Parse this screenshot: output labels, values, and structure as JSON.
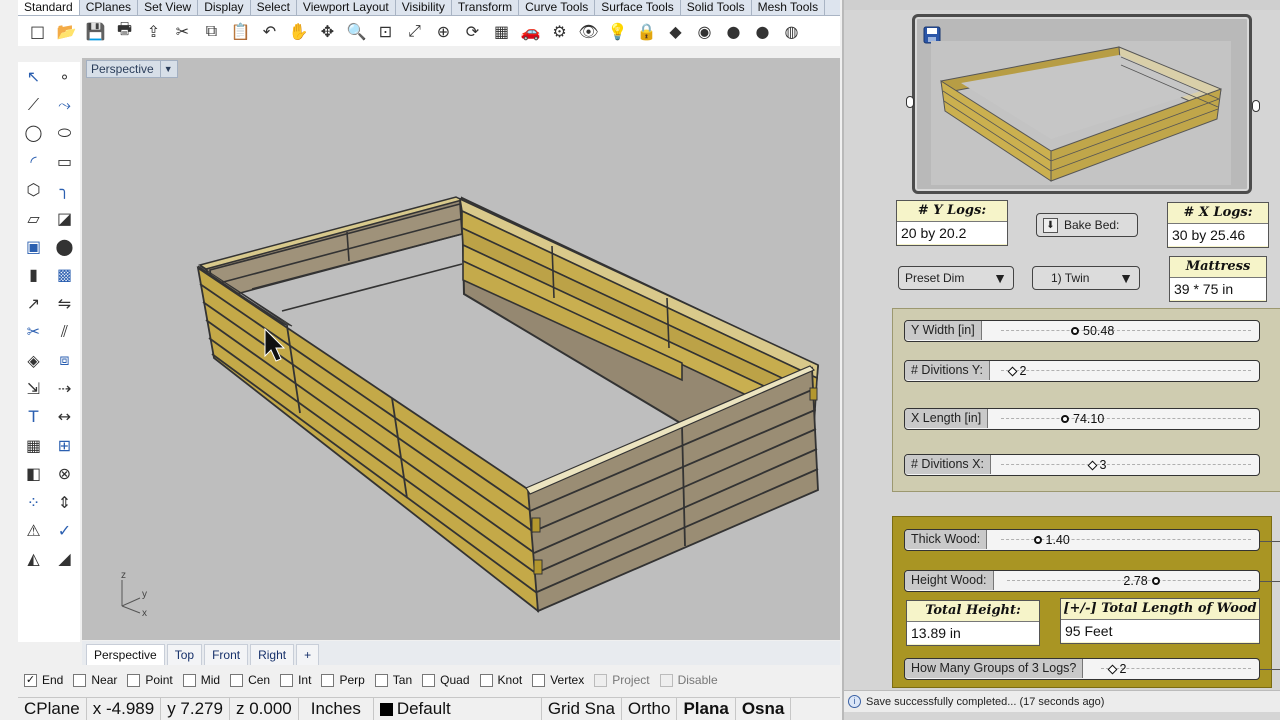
{
  "rhino": {
    "tabs": [
      "Standard",
      "CPlanes",
      "Set View",
      "Display",
      "Select",
      "Viewport Layout",
      "Visibility",
      "Transform",
      "Curve Tools",
      "Surface Tools",
      "Solid Tools",
      "Mesh Tools"
    ],
    "toolbar_icons": [
      "new-file-icon",
      "open-folder-icon",
      "save-icon",
      "print-icon",
      "import-icon",
      "cut-icon",
      "copy-icon",
      "paste-icon",
      "undo-icon",
      "pan-hand-icon",
      "move-view-icon",
      "zoom-icon",
      "zoom-window-icon",
      "zoom-extents-icon",
      "zoom-selected-icon",
      "rotate-view-icon",
      "four-viewports-icon",
      "car-icon",
      "properties-icon",
      "hide-icon",
      "light-bulb-icon",
      "lock-icon",
      "layer-icon",
      "color-wheel-icon",
      "shaded-sphere-icon",
      "rendered-sphere-icon",
      "render-icon"
    ],
    "viewport": {
      "title": "Perspective"
    },
    "view_tabs": [
      "Perspective",
      "Top",
      "Front",
      "Right",
      "+"
    ],
    "osnaps": [
      {
        "label": "End",
        "checked": true
      },
      {
        "label": "Near",
        "checked": false
      },
      {
        "label": "Point",
        "checked": false
      },
      {
        "label": "Mid",
        "checked": false
      },
      {
        "label": "Cen",
        "checked": false
      },
      {
        "label": "Int",
        "checked": false
      },
      {
        "label": "Perp",
        "checked": false
      },
      {
        "label": "Tan",
        "checked": false
      },
      {
        "label": "Quad",
        "checked": false
      },
      {
        "label": "Knot",
        "checked": false
      },
      {
        "label": "Vertex",
        "checked": false
      },
      {
        "label": "Project",
        "checked": false,
        "disabled": true
      },
      {
        "label": "Disable",
        "checked": false,
        "disabled": true
      }
    ],
    "status": {
      "cplane": "CPlane",
      "x": "x -4.989",
      "y": "y 7.279",
      "z": "z 0.000",
      "units": "Inches",
      "layer": "Default",
      "grid_snap": "Grid Sna",
      "ortho": "Ortho",
      "planar": "Plana",
      "osnap": "Osna"
    },
    "axis": {
      "x": "x",
      "y": "y",
      "z": "z"
    }
  },
  "gh": {
    "panels": {
      "y_logs": {
        "header": "# Y Logs:",
        "value": "20 by 20.2"
      },
      "x_logs": {
        "header": "# X Logs:",
        "value": "30 by 25.46"
      },
      "mattress": {
        "header": "Mattress",
        "value": "39 * 75 in"
      },
      "total_height": {
        "header": "Total Height:",
        "value": "13.89 in"
      },
      "total_length": {
        "header": "[+/-] Total Length of Wood",
        "value": "95 Feet"
      }
    },
    "bake_button": "Bake Bed:",
    "preset_dim": "Preset Dim",
    "bed_type": "1) Twin",
    "sliders": {
      "y_width": {
        "label": "Y Width [in]",
        "value": "50.48",
        "pos": 0.28
      },
      "div_y": {
        "label": "# Divitions Y:",
        "value": "2",
        "pos": 0.03
      },
      "x_length": {
        "label": "X Length [in]",
        "value": "74.10",
        "pos": 0.24
      },
      "div_x": {
        "label": "# Divitions X:",
        "value": "3",
        "pos": 0.35
      },
      "thick_wood": {
        "label": "Thick Wood:",
        "value": "1.40",
        "pos": 0.13
      },
      "height_wood": {
        "label": "Height Wood:",
        "value": "2.78",
        "pos": 0.6
      },
      "groups": {
        "label": "How Many Groups of 3 Logs?",
        "value": "2",
        "pos": 0.05
      }
    },
    "message": "Save successfully completed... (17 seconds ago)",
    "colors": {
      "group_yellow": "#a99523",
      "group_grey": "#cfccb0",
      "panel": "#f6f4c9",
      "wood_light": "#c9b04d",
      "wood_dark": "#9a8a6d"
    }
  }
}
